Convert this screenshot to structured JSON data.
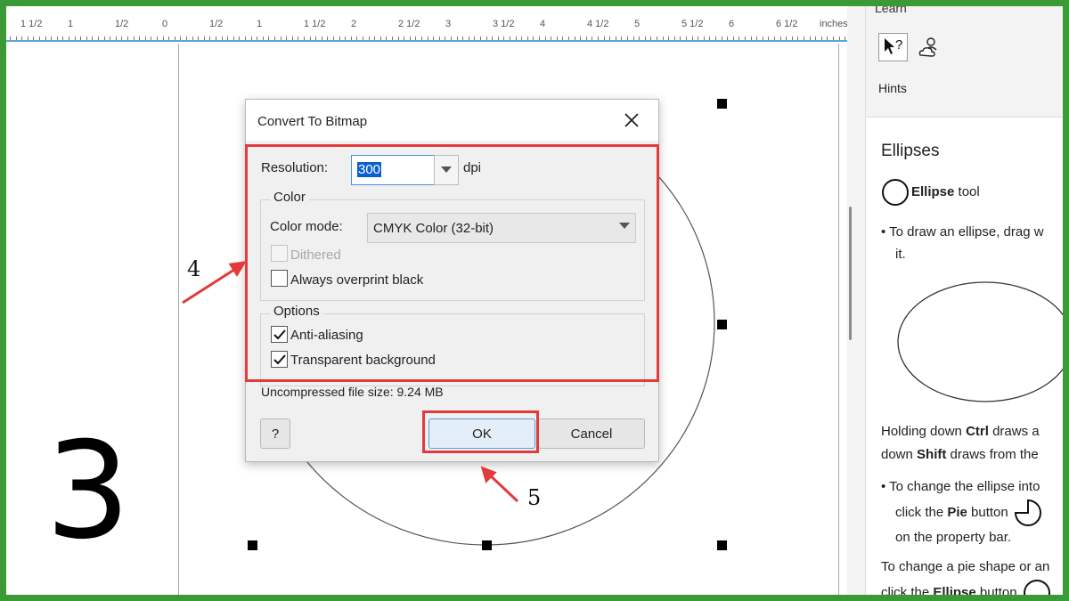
{
  "ruler": {
    "labels": [
      "1 1/2",
      "1",
      "1/2",
      "0",
      "1/2",
      "1",
      "1 1/2",
      "2",
      "2 1/2",
      "3",
      "3 1/2",
      "4",
      "4 1/2",
      "5",
      "5 1/2",
      "6",
      "6 1/2"
    ],
    "unit": "inches"
  },
  "dialog": {
    "title": "Convert To Bitmap",
    "resolution_label": "Resolution:",
    "resolution_value": "300",
    "resolution_unit": "dpi",
    "color_group": "Color",
    "color_mode_label": "Color mode:",
    "color_mode_value": "CMYK Color (32-bit)",
    "dithered_label": "Dithered",
    "dithered_checked": false,
    "dithered_disabled": true,
    "overprint_label": "Always overprint black",
    "overprint_checked": false,
    "options_group": "Options",
    "antialias_label": "Anti-aliasing",
    "antialias_checked": true,
    "transparent_label": "Transparent background",
    "transparent_checked": true,
    "file_size": "Uncompressed file size: 9.24 MB",
    "help_label": "?",
    "ok_label": "OK",
    "cancel_label": "Cancel"
  },
  "annotations": {
    "step_big": "3",
    "step_4": "4",
    "step_5": "5",
    "highlight_color": "#e23b3b"
  },
  "panel": {
    "learn": "Learn",
    "hints": "Hints",
    "title": "Ellipses",
    "tool_name": "Ellipse",
    "tool_suffix": " tool",
    "bullet1_a": "To draw an ellipse, drag w",
    "bullet1_b": "it.",
    "para1_a_pre": "Holding down ",
    "para1_a_bold": "Ctrl",
    "para1_a_post": " draws a",
    "para1_b_pre": "down ",
    "para1_b_bold": "Shift",
    "para1_b_post": " draws from the",
    "bullet2_a": "To change the ellipse into",
    "bullet2_b_pre": "click the ",
    "bullet2_b_bold": "Pie",
    "bullet2_b_post": " button",
    "bullet2_c": "on the property bar.",
    "para2_a": "To change a pie shape or an",
    "para2_b_pre": "click the ",
    "para2_b_bold": "Ellipse",
    "para2_b_post": " button"
  }
}
